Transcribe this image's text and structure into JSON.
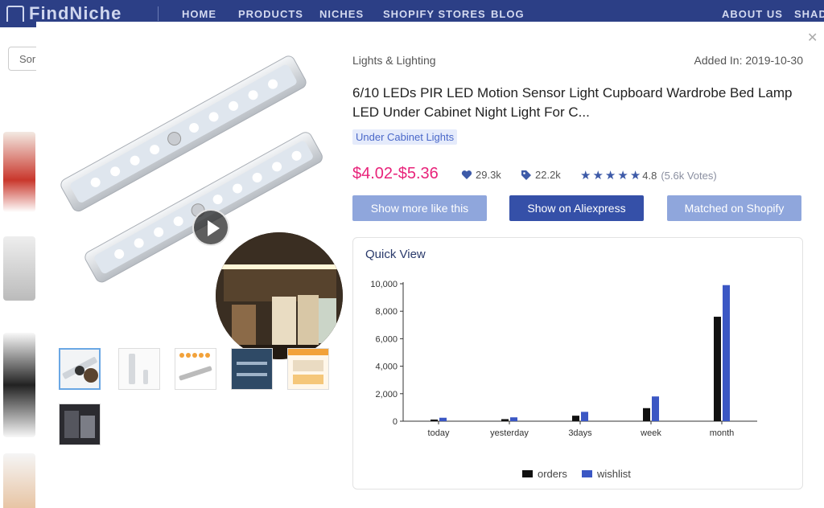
{
  "site": {
    "logo": "FindNiche",
    "nav": [
      "HOME",
      "PRODUCTS",
      "NICHES",
      "SHOPIFY STORES",
      "BLOG"
    ],
    "nav_right": [
      "ABOUT US",
      "SHAD"
    ],
    "sort_label": "Sor"
  },
  "product": {
    "category": "Lights & Lighting",
    "added": "Added In: 2019-10-30",
    "title": "6/10 LEDs PIR LED Motion Sensor Light Cupboard Wardrobe Bed Lamp LED Under Cabinet Night Light For C...",
    "tag": "Under Cabinet Lights",
    "price": "$4.02-$5.36",
    "likes": "29.3k",
    "saves": "22.2k",
    "rating": "4.8",
    "rating_stars": 5,
    "votes": "(5.6k Votes)"
  },
  "buttons": {
    "more_like": "Show more like this",
    "aliexpress": "Show on Aliexpress",
    "shopify": "Matched on Shopify"
  },
  "quick_view": {
    "title": "Quick View"
  },
  "colors": {
    "orders": "#111111",
    "wishlist": "#3b57c4",
    "price": "#e8237a"
  },
  "chart_data": {
    "type": "bar",
    "categories": [
      "today",
      "yesterday",
      "3days",
      "week",
      "month"
    ],
    "series": [
      {
        "name": "orders",
        "values": [
          120,
          150,
          400,
          950,
          7600
        ]
      },
      {
        "name": "wishlist",
        "values": [
          250,
          280,
          680,
          1800,
          9900
        ]
      }
    ],
    "yticks": [
      "0",
      "2,000",
      "4,000",
      "6,000",
      "8,000",
      "10,000"
    ],
    "ylim": [
      0,
      10000
    ],
    "legend": "bottom"
  }
}
